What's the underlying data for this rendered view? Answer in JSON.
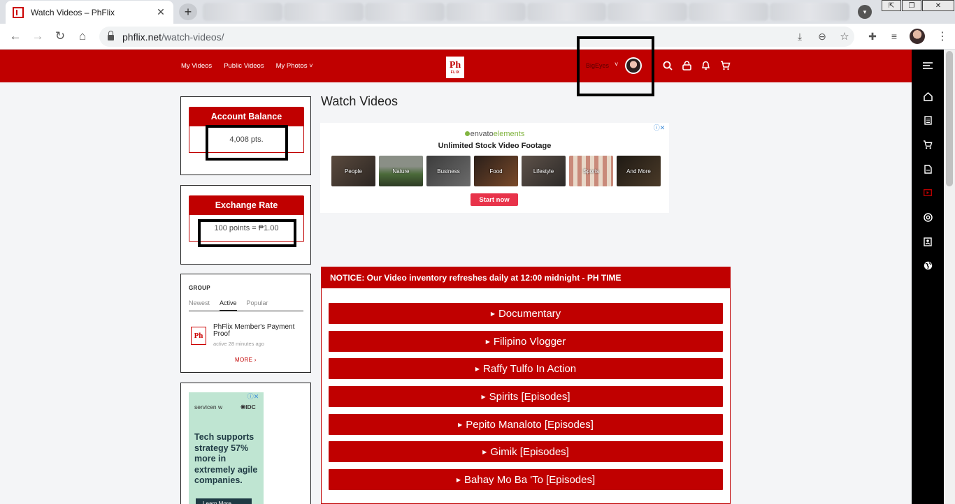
{
  "browser": {
    "tab_title": "Watch Videos – PhFlix",
    "tab_close": "✕",
    "new_tab": "+",
    "url_host": "phflix.net",
    "url_path": "/watch-videos/",
    "window_controls": [
      "⇱",
      "❐",
      "✕"
    ]
  },
  "header": {
    "nav": [
      "My Videos",
      "Public Videos",
      "My Photos ˅"
    ],
    "logo_text": "Ph",
    "logo_sub": "FLIX",
    "username": "BigEyes",
    "user_caret": "˅",
    "icons": [
      "search-icon",
      "lock-icon",
      "bell-icon",
      "cart-icon"
    ]
  },
  "sidebar_icons": [
    "menu-icon",
    "home-icon",
    "document-icon",
    "cart-icon",
    "file-icon",
    "video-icon",
    "at-icon",
    "contacts-icon",
    "globe-icon"
  ],
  "account": {
    "balance_title": "Account Balance",
    "balance_value": "4,008 pts.",
    "rate_title": "Exchange Rate",
    "rate_value": "100 points = ₱1.00"
  },
  "group": {
    "title": "GROUP",
    "tabs": [
      "Newest",
      "Active",
      "Popular"
    ],
    "active_tab": "Active",
    "item_name": "PhFlix Member's Payment Proof",
    "item_time": "active 28 minutes ago",
    "more": "MORE  ›"
  },
  "ad_left": {
    "brand": "servicen  w",
    "brand2": "❋IDC",
    "text": "Tech supports strategy 57% more in extremely agile companies.",
    "button": "Learn More"
  },
  "main": {
    "title": "Watch Videos",
    "ad": {
      "brand": "envato",
      "brand_suffix": "elements",
      "headline": "Unlimited Stock Video Footage",
      "thumbs": [
        "People",
        "Nature",
        "Business",
        "Food",
        "Lifestyle",
        "Sports",
        "And More"
      ],
      "cta": "Start now"
    },
    "notice": "NOTICE: Our Video inventory refreshes daily at 12:00 midnight - PH TIME",
    "categories": [
      "Documentary",
      "Filipino Vlogger",
      "Raffy Tulfo In Action",
      "Spirits [Episodes]",
      "Pepito Manaloto [Episodes]",
      "Gimik [Episodes]",
      "Bahay Mo Ba 'To [Episodes]"
    ]
  },
  "colors": {
    "brand_red": "#c00000",
    "sidebar_black": "#000000",
    "ad_green": "#bfe5d2",
    "cta_pink": "#e8334a"
  }
}
